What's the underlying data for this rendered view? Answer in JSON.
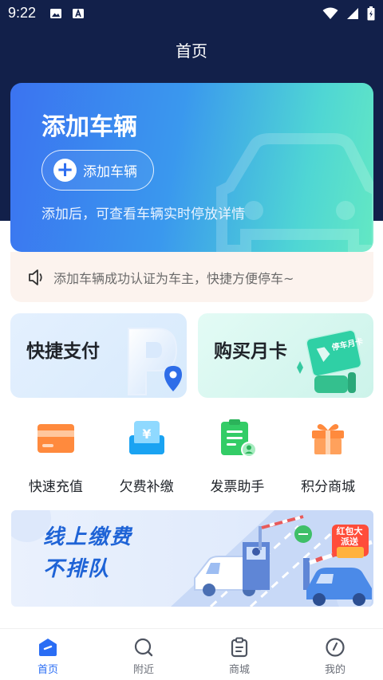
{
  "status_bar": {
    "time": "9:22"
  },
  "header": {
    "title": "首页"
  },
  "vehicle_card": {
    "title": "添加车辆",
    "button_label": "添加车辆",
    "description": "添加后，可查看车辆实时停放详情"
  },
  "notice": {
    "text": "添加车辆成功认证为车主，快捷方便停车~"
  },
  "tiles": [
    {
      "label": "快捷支付",
      "art_text": ""
    },
    {
      "label": "购买月卡",
      "art_text": "停车月卡"
    }
  ],
  "services": [
    {
      "label": "快速充值",
      "icon": "card-icon"
    },
    {
      "label": "欠费补缴",
      "icon": "wallet-yuan-icon",
      "icon_text": "¥"
    },
    {
      "label": "发票助手",
      "icon": "invoice-icon"
    },
    {
      "label": "积分商城",
      "icon": "gift-icon"
    }
  ],
  "banner": {
    "line1": "线上缴费",
    "line2": "不排队",
    "badge_text": "红包大派送"
  },
  "bottom_nav": [
    {
      "label": "首页",
      "icon": "home-icon",
      "active": true
    },
    {
      "label": "附近",
      "icon": "search-icon",
      "active": false
    },
    {
      "label": "商城",
      "icon": "clipboard-icon",
      "active": false
    },
    {
      "label": "我的",
      "icon": "profile-icon",
      "active": false
    }
  ],
  "colors": {
    "header_bg": "#12204a",
    "accent": "#2a6df4",
    "card_gradient_start": "#3b73f0",
    "card_gradient_end": "#63e8c3"
  }
}
